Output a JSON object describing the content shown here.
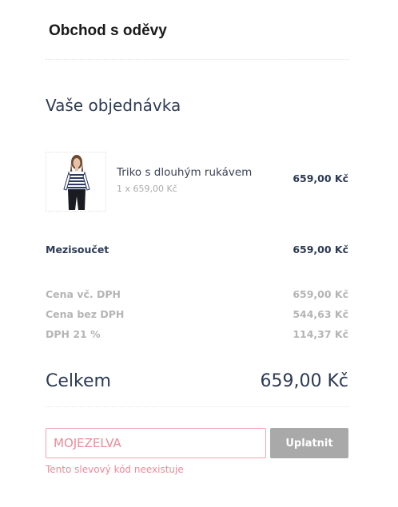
{
  "shop": {
    "title": "Obchod s oděvy"
  },
  "order": {
    "heading": "Vaše objednávka",
    "item": {
      "name": "Triko s dlouhým rukávem",
      "quantity_line": "1 x 659,00 Kč",
      "price": "659,00 Kč"
    },
    "subtotal": {
      "label": "Mezisoučet",
      "value": "659,00 Kč"
    },
    "taxes": [
      {
        "label": "Cena vč. DPH",
        "value": "659,00 Kč"
      },
      {
        "label": "Cena bez DPH",
        "value": "544,63 Kč"
      },
      {
        "label": "DPH 21 %",
        "value": "114,37 Kč"
      }
    ],
    "total": {
      "label": "Celkem",
      "value": "659,00 Kč"
    }
  },
  "coupon": {
    "value": "MOJEZELVA",
    "apply_label": "Uplatnit",
    "error": "Tento slevový kód neexistuje"
  },
  "colors": {
    "accent_error": "#f08a99",
    "button_disabled": "#a9a9a9",
    "heading": "#2d3a55"
  }
}
